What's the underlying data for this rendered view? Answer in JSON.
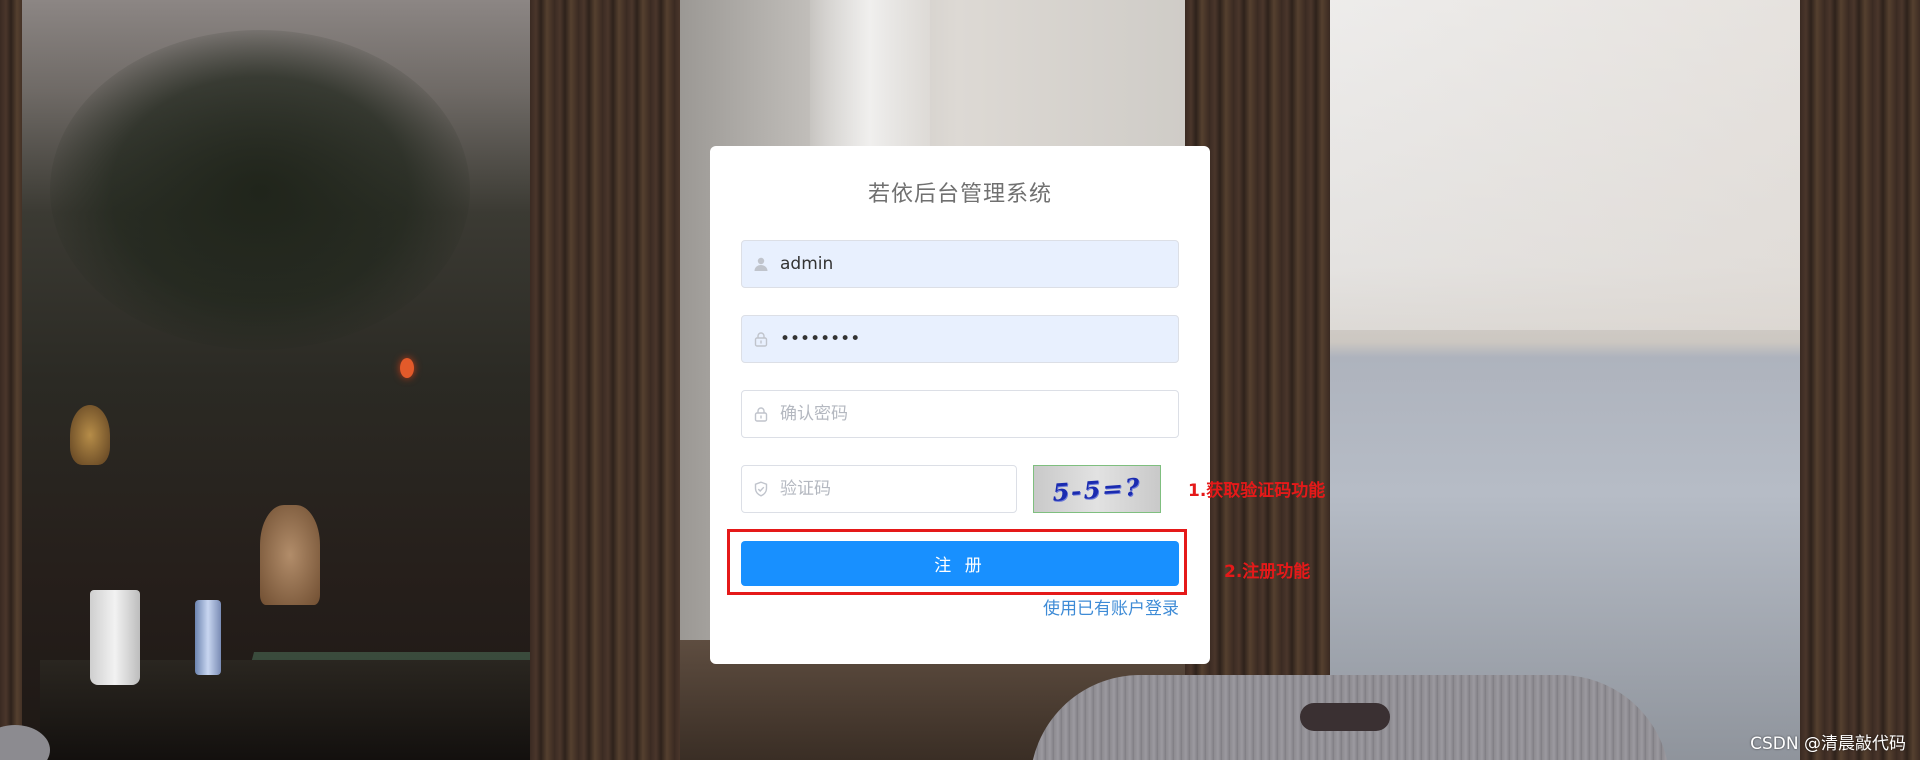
{
  "app": {
    "title": "若依后台管理系统"
  },
  "form": {
    "username": {
      "value": "admin",
      "placeholder": ""
    },
    "password": {
      "value": "12345678",
      "placeholder": ""
    },
    "confirm_password": {
      "value": "",
      "placeholder": "确认密码"
    },
    "captcha": {
      "value": "",
      "placeholder": "验证码",
      "image_text": "5-5=?"
    },
    "register_label": "注 册",
    "login_link": "使用已有账户登录"
  },
  "annotations": {
    "note_1": "1.获取验证码功能",
    "note_2": "2.注册功能",
    "highlight_color": "#e51919"
  },
  "watermark": "CSDN @清晨敲代码",
  "colors": {
    "primary": "#1890ff",
    "link": "#3e8bd6",
    "autofill": "#e8f0fe"
  }
}
